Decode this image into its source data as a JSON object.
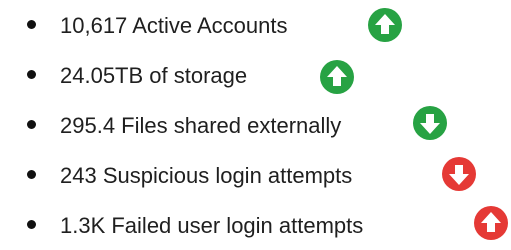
{
  "stats": [
    {
      "label": "10,617 Active Accounts",
      "trend": "up-arrow-icon",
      "color": "#27a243"
    },
    {
      "label": "24.05TB of storage",
      "trend": "up-arrow-icon",
      "color": "#27a243"
    },
    {
      "label": "295.4 Files shared externally",
      "trend": "down-arrow-icon",
      "color": "#27a243"
    },
    {
      "label": "243 Suspicious login attempts",
      "trend": "down-arrow-icon",
      "color": "#e53935"
    },
    {
      "label": "1.3K Failed user login attempts",
      "trend": "up-arrow-icon",
      "color": "#e53935"
    }
  ]
}
